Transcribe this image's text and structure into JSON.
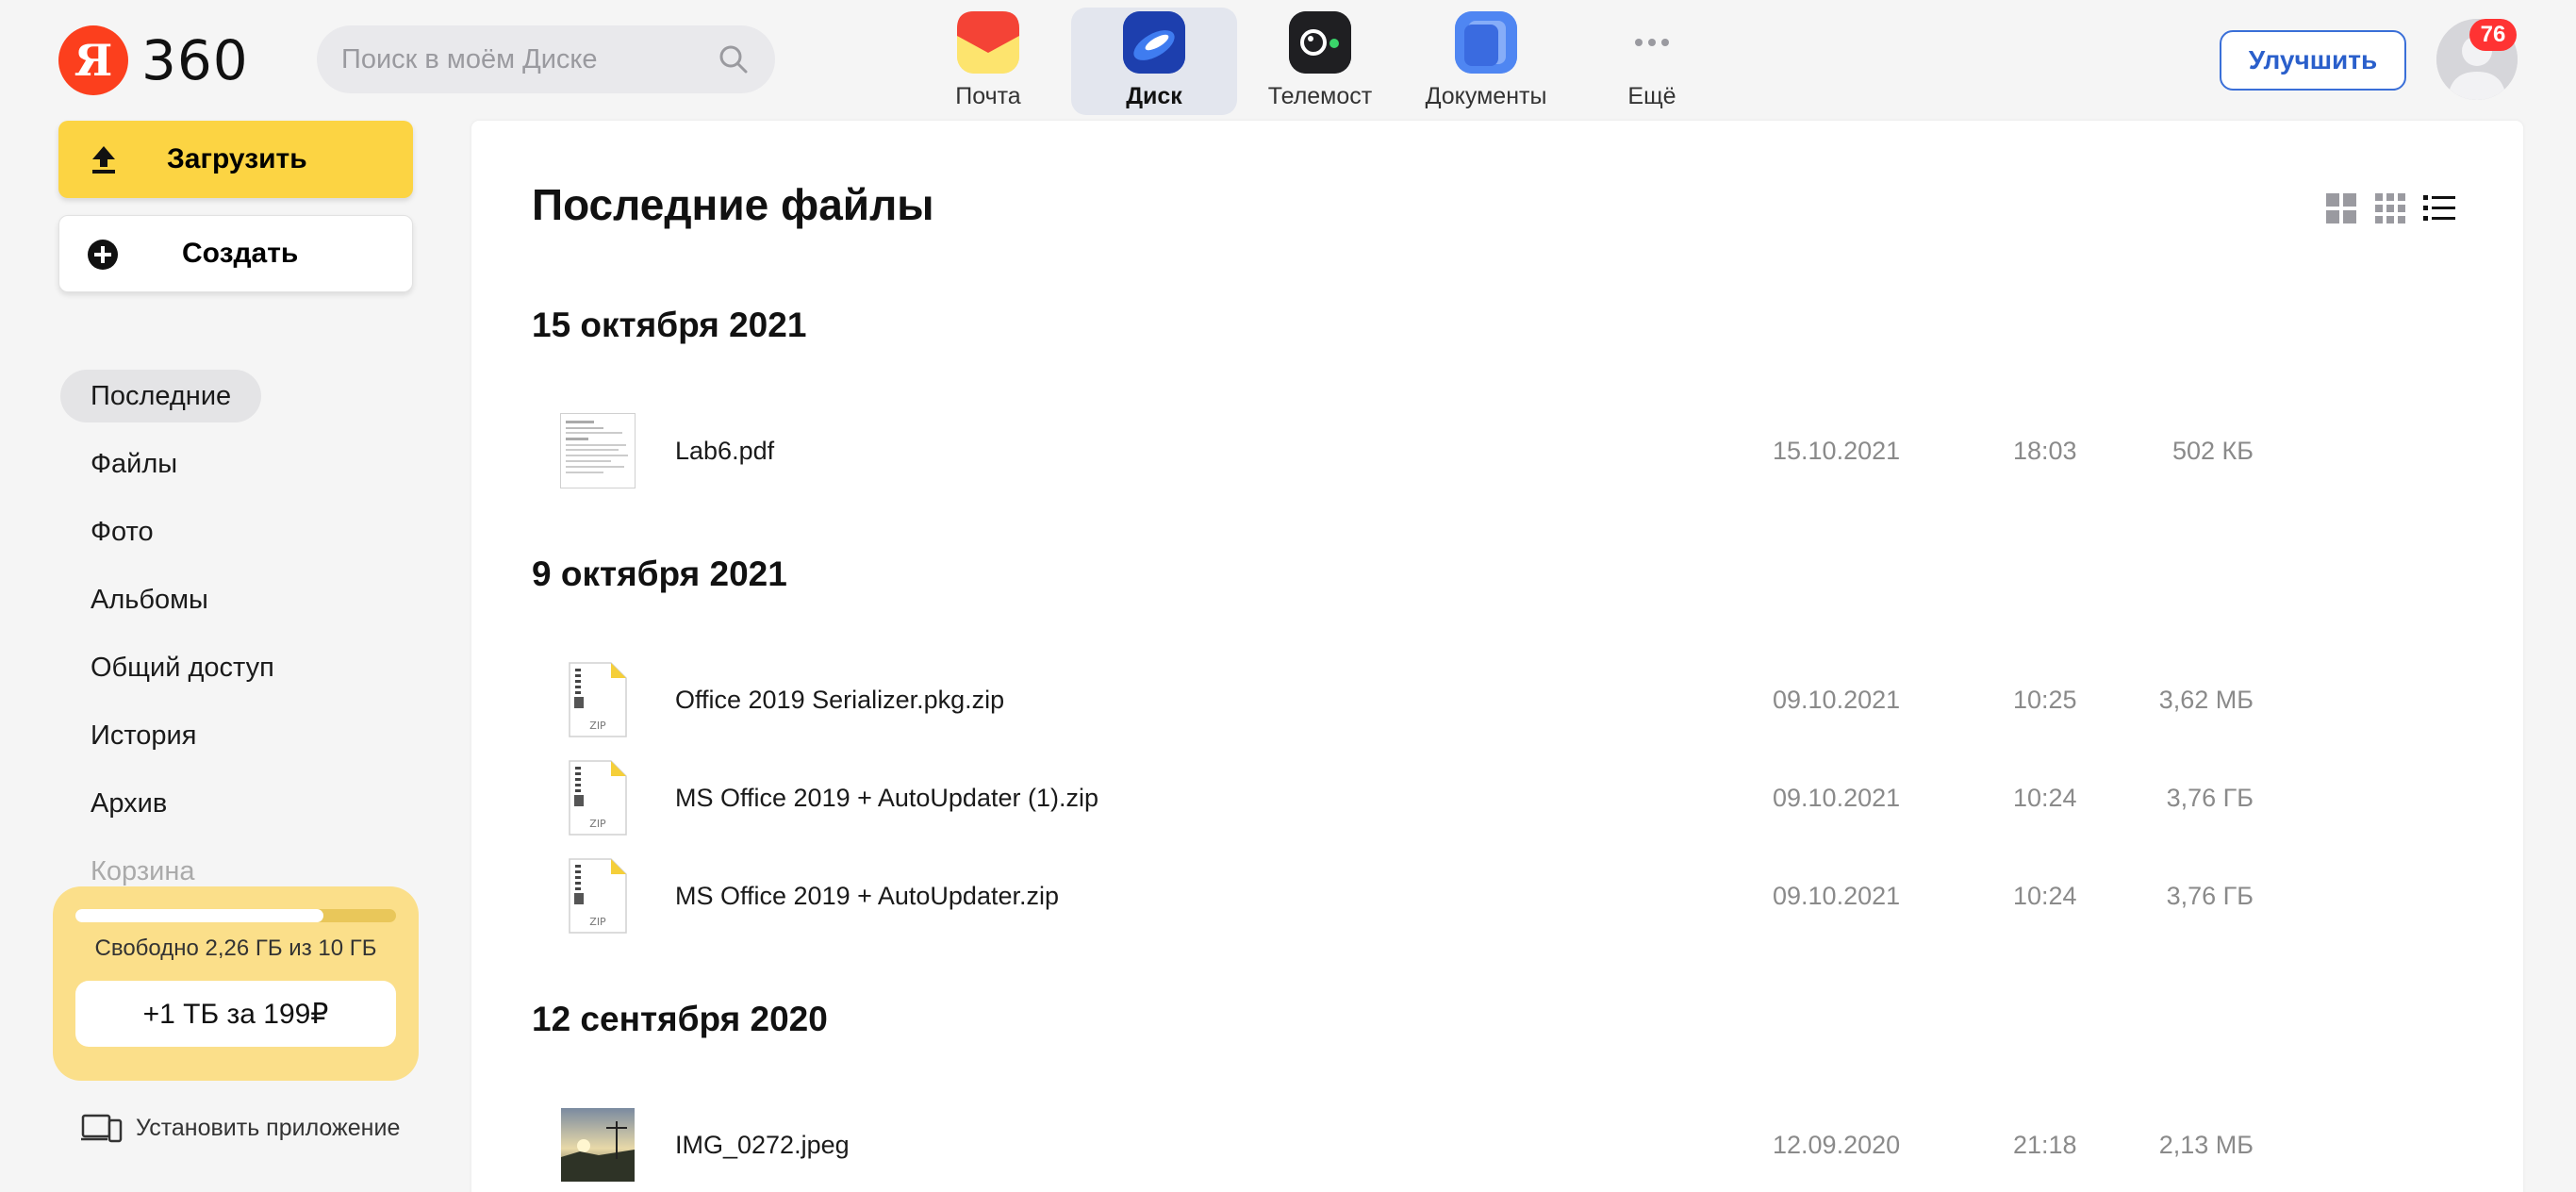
{
  "logo": {
    "letter": "Я",
    "text": "360"
  },
  "search": {
    "placeholder": "Поиск в моём Диске"
  },
  "apps": [
    {
      "label": "Почта",
      "icon": "mail-icon"
    },
    {
      "label": "Диск",
      "icon": "disk-icon",
      "active": true
    },
    {
      "label": "Телемост",
      "icon": "telemost-icon"
    },
    {
      "label": "Документы",
      "icon": "documents-icon"
    },
    {
      "label": "Ещё",
      "icon": "more-icon"
    }
  ],
  "header": {
    "improve_label": "Улучшить",
    "notifications": "76"
  },
  "sidebar": {
    "upload_label": "Загрузить",
    "create_label": "Создать",
    "items": [
      {
        "label": "Последние",
        "active": true
      },
      {
        "label": "Файлы"
      },
      {
        "label": "Фото"
      },
      {
        "label": "Альбомы"
      },
      {
        "label": "Общий доступ"
      },
      {
        "label": "История"
      },
      {
        "label": "Архив"
      },
      {
        "label": "Корзина"
      }
    ],
    "storage": {
      "used_fraction": 0.774,
      "text": "Свободно 2,26 ГБ из 10 ГБ",
      "offer": "+1 ТБ за 199₽"
    },
    "install_label": "Установить приложение"
  },
  "main": {
    "title": "Последние файлы",
    "groups": [
      {
        "date": "15 октября 2021",
        "files": [
          {
            "name": "Lab6.pdf",
            "date": "15.10.2021",
            "time": "18:03",
            "size": "502 КБ",
            "type": "pdf"
          }
        ]
      },
      {
        "date": "9 октября 2021",
        "files": [
          {
            "name": "Office 2019 Serializer.pkg.zip",
            "date": "09.10.2021",
            "time": "10:25",
            "size": "3,62 МБ",
            "type": "zip"
          },
          {
            "name": "MS Office 2019 + AutoUpdater (1).zip",
            "date": "09.10.2021",
            "time": "10:24",
            "size": "3,76 ГБ",
            "type": "zip"
          },
          {
            "name": "MS Office 2019 + AutoUpdater.zip",
            "date": "09.10.2021",
            "time": "10:24",
            "size": "3,76 ГБ",
            "type": "zip"
          }
        ]
      },
      {
        "date": "12 сентября 2020",
        "files": [
          {
            "name": "IMG_0272.jpeg",
            "date": "12.09.2020",
            "time": "21:18",
            "size": "2,13 МБ",
            "type": "image"
          }
        ]
      }
    ]
  },
  "colors": {
    "accent_yellow": "#fcd443",
    "brand_red": "#fc3f1d",
    "link_blue": "#2a5fcb",
    "badge_red": "#ff3333"
  }
}
